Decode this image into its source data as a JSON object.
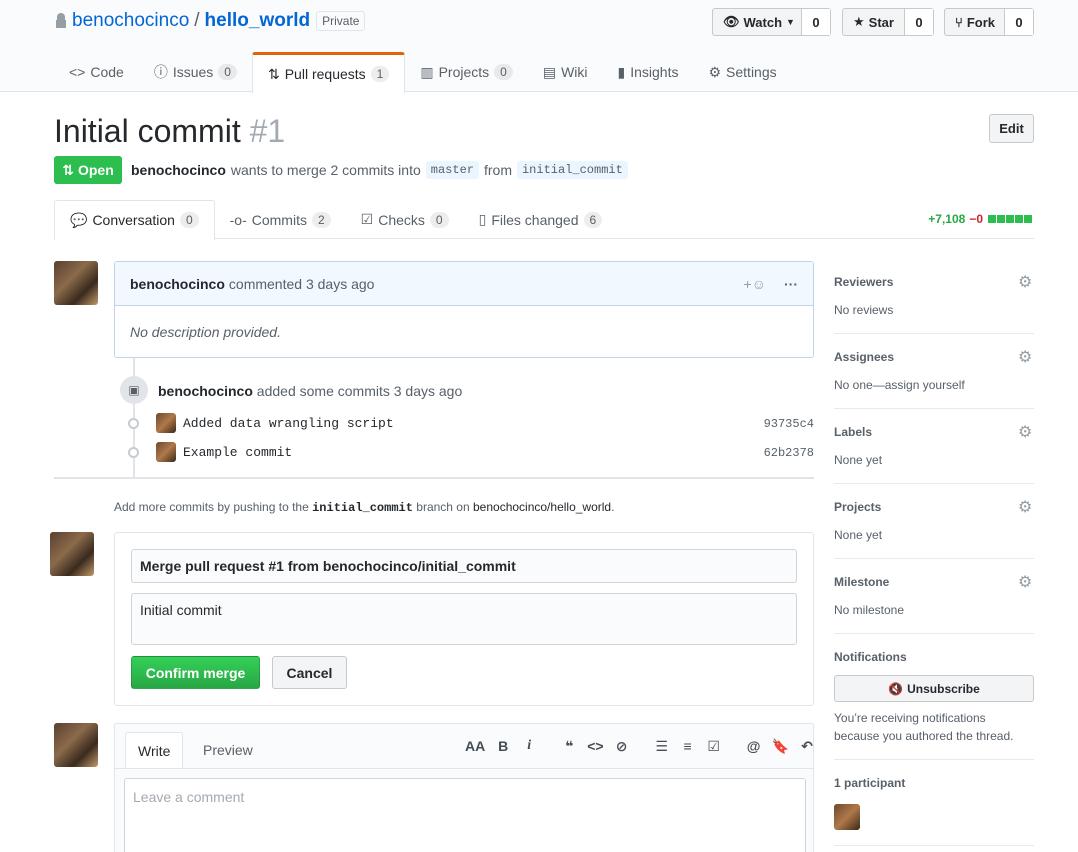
{
  "repo": {
    "owner": "benochocinco",
    "separator": "/",
    "name": "hello_world",
    "visibility": "Private"
  },
  "header_buttons": {
    "watch": {
      "label": "Watch",
      "count": "0"
    },
    "star": {
      "label": "Star",
      "count": "0"
    },
    "fork": {
      "label": "Fork",
      "count": "0"
    }
  },
  "repo_tabs": [
    {
      "label": "Code",
      "count": ""
    },
    {
      "label": "Issues",
      "count": "0"
    },
    {
      "label": "Pull requests",
      "count": "1"
    },
    {
      "label": "Projects",
      "count": "0"
    },
    {
      "label": "Wiki",
      "count": ""
    },
    {
      "label": "Insights",
      "count": ""
    },
    {
      "label": "Settings",
      "count": ""
    }
  ],
  "pr": {
    "title": "Initial commit",
    "number": "#1",
    "edit_label": "Edit",
    "state": "Open",
    "author": "benochocinco",
    "merge_text": "wants to merge 2 commits into",
    "base_branch": "master",
    "from_text": "from",
    "head_branch": "initial_commit"
  },
  "pr_tabs": [
    {
      "label": "Conversation",
      "count": "0"
    },
    {
      "label": "Commits",
      "count": "2"
    },
    {
      "label": "Checks",
      "count": "0"
    },
    {
      "label": "Files changed",
      "count": "6"
    }
  ],
  "diffstat": {
    "additions": "+7,108",
    "deletions": "−0"
  },
  "comment": {
    "author": "benochocinco",
    "action": "commented 3 days ago",
    "reaction": "+☺",
    "more": "···",
    "body": "No description provided."
  },
  "commit_event": {
    "author": "benochocinco",
    "action": "added some commits 3 days ago"
  },
  "commits": [
    {
      "message": "Added data wrangling script",
      "sha": "93735c4"
    },
    {
      "message": "Example commit",
      "sha": "62b2378"
    }
  ],
  "push_note": {
    "prefix": "Add more commits by pushing to the",
    "branch": "initial_commit",
    "middle": "branch on",
    "repo": "benochocinco/hello_world",
    "suffix": "."
  },
  "merge": {
    "title_value": "Merge pull request #1 from benochocinco/initial_commit",
    "body_value": "Initial commit",
    "confirm_label": "Confirm merge",
    "cancel_label": "Cancel"
  },
  "editor": {
    "write_tab": "Write",
    "preview_tab": "Preview",
    "placeholder": "Leave a comment",
    "toolbar": [
      "AA",
      "B",
      "i",
      "❝",
      "<>",
      "⊘",
      "☰",
      "≡",
      "☑",
      "@",
      "🔖",
      "↶"
    ]
  },
  "sidebar": {
    "reviewers": {
      "title": "Reviewers",
      "value": "No reviews"
    },
    "assignees": {
      "title": "Assignees",
      "value": "No one—assign yourself"
    },
    "labels": {
      "title": "Labels",
      "value": "None yet"
    },
    "projects": {
      "title": "Projects",
      "value": "None yet"
    },
    "milestone": {
      "title": "Milestone",
      "value": "No milestone"
    },
    "notifications": {
      "title": "Notifications",
      "button": "Unsubscribe",
      "reason": "You’re receiving notifications because you authored the thread."
    },
    "participants": {
      "title": "1 participant"
    }
  },
  "colors": {
    "accent_orange": "#e36209",
    "open_green": "#2cbe4e",
    "link_blue": "#0366d6"
  }
}
